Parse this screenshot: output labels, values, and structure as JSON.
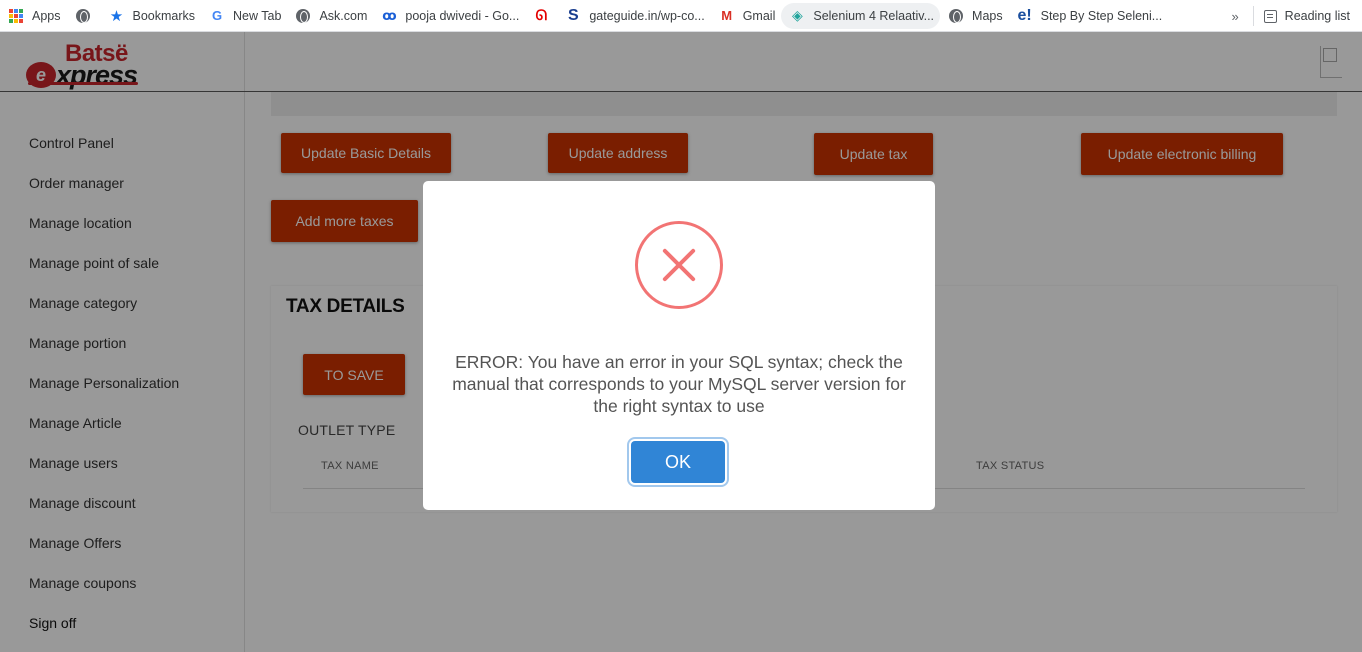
{
  "bookmarks": [
    {
      "label": "Apps",
      "icon": "apps-grid-icon"
    },
    {
      "label": "Bookmarks",
      "icon": "star-icon"
    },
    {
      "label": "New Tab",
      "icon": "google-icon"
    },
    {
      "label": "Ask.com",
      "icon": "globe-icon"
    },
    {
      "label": "pooja dwivedi - Go...",
      "icon": "people-icon"
    },
    {
      "label": "",
      "icon": "airtel-icon"
    },
    {
      "label": "gateguide.in/wp-co...",
      "icon": "s-logo-icon"
    },
    {
      "label": "Gmail",
      "icon": "gmail-icon"
    },
    {
      "label": "Selenium 4 Relaativ...",
      "icon": "selenium-icon"
    },
    {
      "label": "Maps",
      "icon": "globe-icon"
    },
    {
      "label": "Step By Step Seleni...",
      "icon": "e-logo-icon"
    }
  ],
  "reading_list": "Reading list",
  "overflow_glyph": "»",
  "logo": {
    "top": "Batsë",
    "bottom": "xpress",
    "mark": "e"
  },
  "sidebar": {
    "items": [
      "Control Panel",
      "Order manager",
      "Manage location",
      "Manage point of sale",
      "Manage category",
      "Manage portion",
      "Manage Personalization",
      "Manage Article",
      "Manage users",
      "Manage discount",
      "Manage Offers",
      "Manage coupons",
      "Sign off"
    ]
  },
  "actions": {
    "update_basic": "Update Basic Details",
    "update_address": "Update address",
    "update_tax": "Update tax",
    "update_billing": "Update electronic billing",
    "add_taxes": "Add more taxes"
  },
  "tax_details": {
    "title": "TAX DETAILS",
    "save_label": "TO SAVE",
    "outlet_type": "OUTLET TYPE",
    "columns": [
      "TAX NAME",
      "TAX STATUS"
    ]
  },
  "dialog": {
    "message": "ERROR: You have an error in your SQL syntax; check the manual that corresponds to your MySQL server version for the right syntax to use",
    "ok_label": "OK"
  },
  "colors": {
    "brand_red": "#cc3300",
    "error_icon": "#f27474",
    "ok_blue": "#3085d6"
  }
}
